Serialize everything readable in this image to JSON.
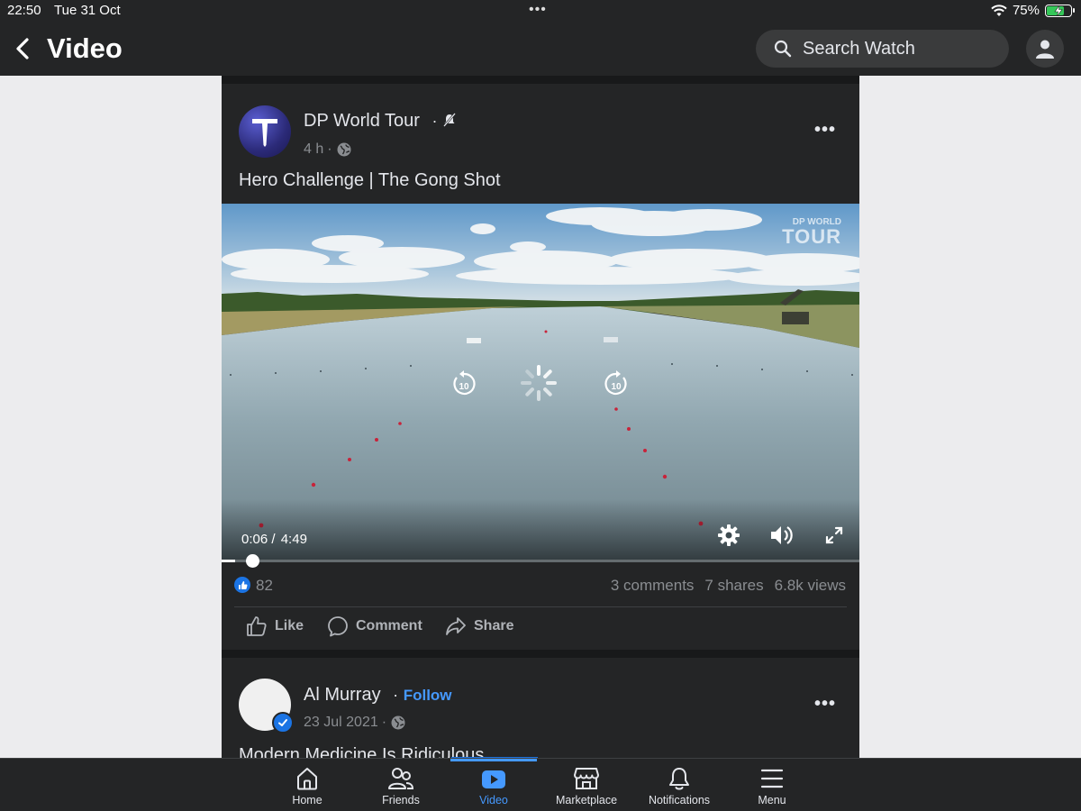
{
  "status_bar": {
    "time": "22:50",
    "date": "Tue 31 Oct",
    "battery_percent": "75%",
    "battery_level": 0.75
  },
  "header": {
    "title": "Video",
    "search_placeholder": "Search Watch"
  },
  "posts": [
    {
      "page_name": "DP World Tour",
      "time_ago": "4 h",
      "text": "Hero Challenge | The Gong Shot",
      "video": {
        "current_time": "0:06",
        "separator": " / ",
        "duration": "4:49",
        "progress": 0.021,
        "watermark_line1": "DP WORLD",
        "watermark_line2": "TOUR"
      },
      "reactions_count": "82",
      "comments": "3 comments",
      "shares": "7 shares",
      "views": "6.8k views",
      "actions": {
        "like": "Like",
        "comment": "Comment",
        "share": "Share"
      }
    },
    {
      "page_name": "Al Murray",
      "follow_label": "Follow",
      "date": "23 Jul 2021",
      "text": "Modern Medicine Is Ridiculous"
    }
  ],
  "bottom_nav": [
    {
      "label": "Home",
      "icon": "home-icon"
    },
    {
      "label": "Friends",
      "icon": "friends-icon"
    },
    {
      "label": "Video",
      "icon": "video-icon",
      "active": true
    },
    {
      "label": "Marketplace",
      "icon": "marketplace-icon"
    },
    {
      "label": "Notifications",
      "icon": "bell-icon"
    },
    {
      "label": "Menu",
      "icon": "menu-icon"
    }
  ],
  "colors": {
    "accent": "#4599ff",
    "facebook_blue": "#1b74e4",
    "surface": "#242526",
    "background": "#18191a"
  }
}
